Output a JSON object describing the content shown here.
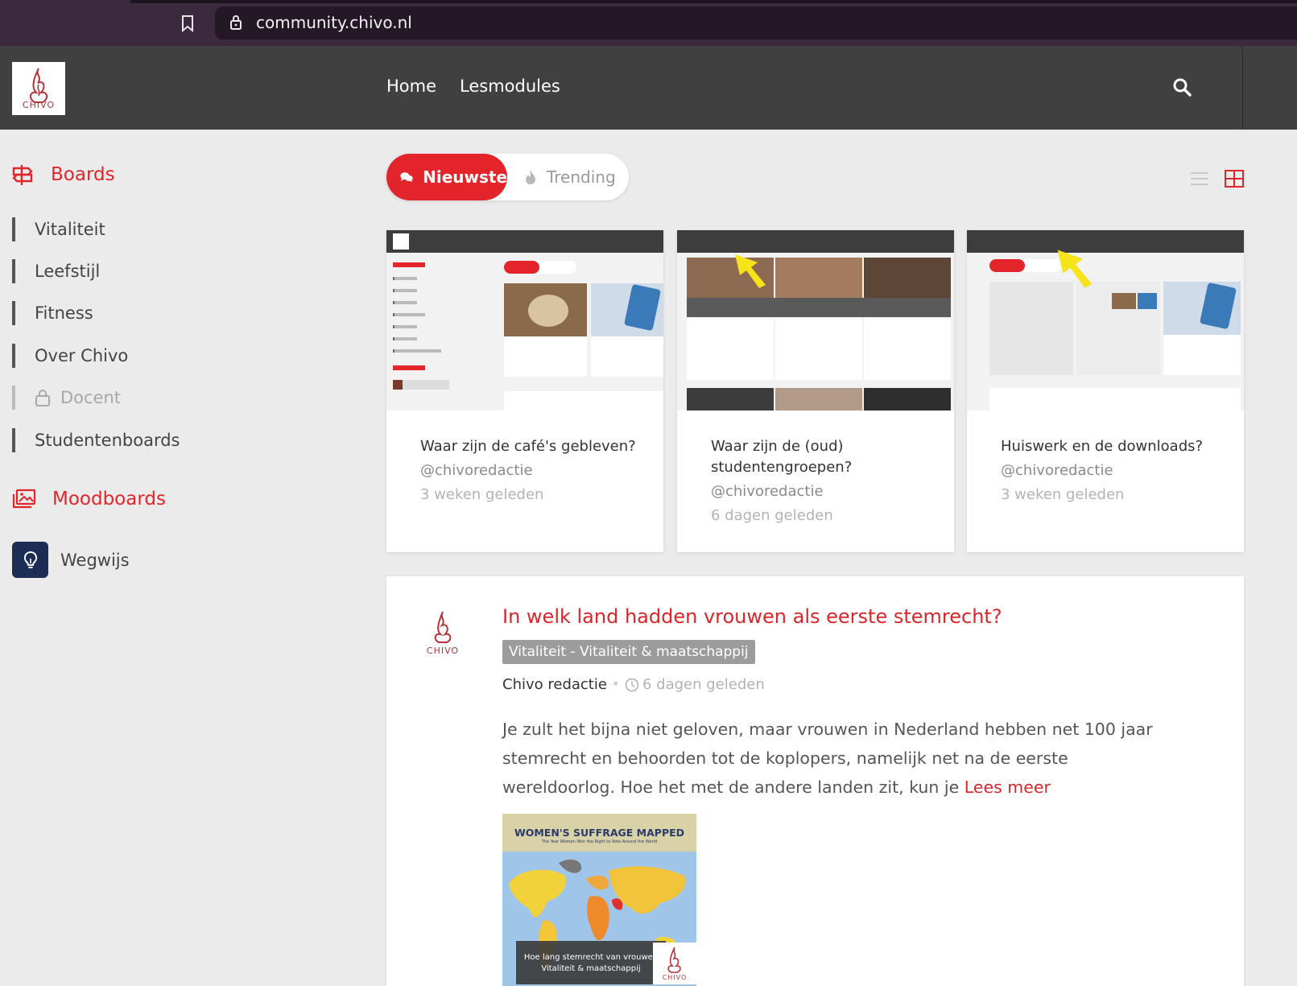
{
  "browser": {
    "url": "community.chivo.nl"
  },
  "header": {
    "logo_text": "CHIVO",
    "nav": [
      "Home",
      "Lesmodules"
    ]
  },
  "sidebar": {
    "boards_heading": "Boards",
    "items": [
      {
        "label": "Vitaliteit",
        "disabled": false
      },
      {
        "label": "Leefstijl",
        "disabled": false
      },
      {
        "label": "Fitness",
        "disabled": false
      },
      {
        "label": "Over Chivo",
        "disabled": false
      },
      {
        "label": "Docent",
        "disabled": true
      },
      {
        "label": "Studentenboards",
        "disabled": false
      }
    ],
    "moodboards_heading": "Moodboards",
    "wegwijs": "Wegwijs"
  },
  "toggle": {
    "active": "Nieuwste",
    "inactive": "Trending"
  },
  "cards": [
    {
      "title": "Waar zijn de café's gebleven?",
      "author": "@chivoredactie",
      "time": "3 weken geleden"
    },
    {
      "title": "Waar zijn de (oud) studentengroepen?",
      "author": "@chivoredactie",
      "time": "6 dagen geleden"
    },
    {
      "title": "Huiswerk en de downloads?",
      "author": "@chivoredactie",
      "time": "3 weken geleden"
    }
  ],
  "post": {
    "title": "In welk land hadden vrouwen als eerste stemrecht?",
    "tag": "Vitaliteit - Vitaliteit & maatschappij",
    "author": "Chivo redactie",
    "separator": "•",
    "time": "6 dagen geleden",
    "body": "Je zult het bijna niet geloven, maar vrouwen in Nederland hebben net 100 jaar stemrecht en behoorden tot de koplopers, namelijk net na de eerste wereldoorlog. Hoe het met de andere landen zit, kun je",
    "read_more": "Lees meer",
    "image": {
      "title": "WOMEN'S SUFFRAGE MAPPED",
      "subtitle": "The Year Women Won the Right to Vote Around the World",
      "caption_line1": "Hoe lang stemrecht van vrouwen",
      "caption_line2": "Vitaliteit & maatschappij",
      "logo_text": "CHIVO"
    }
  },
  "colors": {
    "accent": "#e3242b",
    "header_bg": "#404040",
    "browser_bg": "#3b2a3d",
    "wegwijs_bg": "#1b2d55"
  }
}
